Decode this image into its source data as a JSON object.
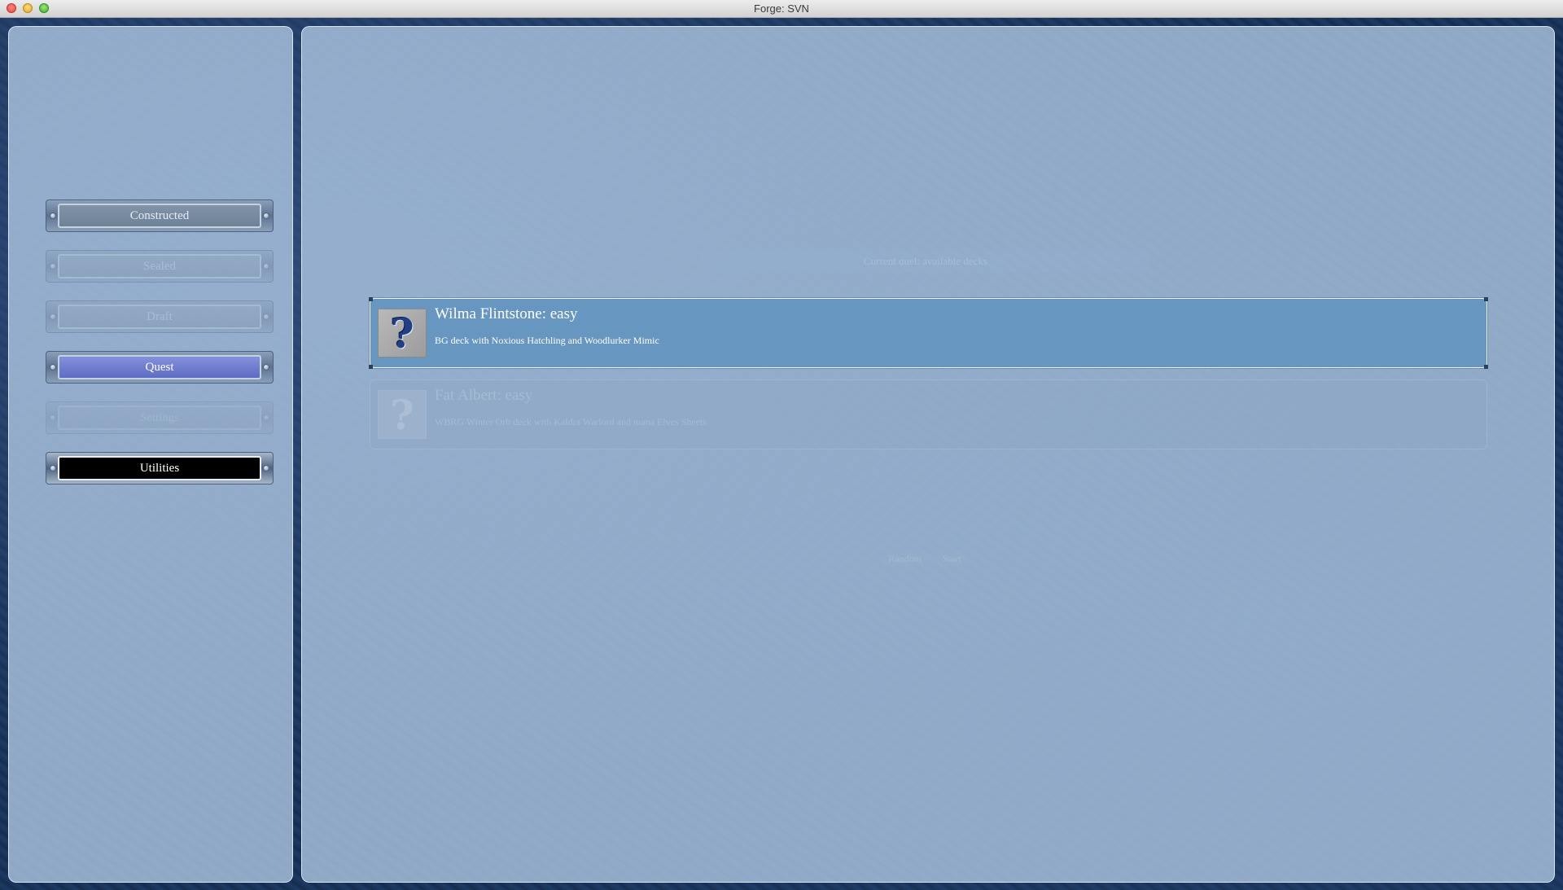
{
  "window": {
    "title": "Forge: SVN"
  },
  "nav": {
    "items": [
      {
        "label": "Constructed",
        "state": "normal"
      },
      {
        "label": "Sealed",
        "state": "dim"
      },
      {
        "label": "Draft",
        "state": "dim"
      },
      {
        "label": "Quest",
        "state": "active"
      },
      {
        "label": "Settings",
        "state": "faint"
      },
      {
        "label": "Utilities",
        "state": "dark"
      }
    ]
  },
  "main": {
    "header_label": "Current duel: available decks",
    "opponents": [
      {
        "title": "Wilma Flintstone: easy",
        "description": "BG deck with Noxious Hatchling and Woodlurker Mimic",
        "avatar_glyph": "?",
        "selected": true
      },
      {
        "title": "Fat Albert: easy",
        "description": "WBRG Winter Orb deck with Kaldra Warlord and mana Elves Sheets",
        "avatar_glyph": "?",
        "selected": false
      }
    ],
    "bottom_controls": [
      "Random",
      "Start"
    ]
  },
  "colors": {
    "panel": "#b2cbe6",
    "selected_row": "#6796c0",
    "active_nav": "#6f7ed0",
    "background": "#18335a"
  }
}
